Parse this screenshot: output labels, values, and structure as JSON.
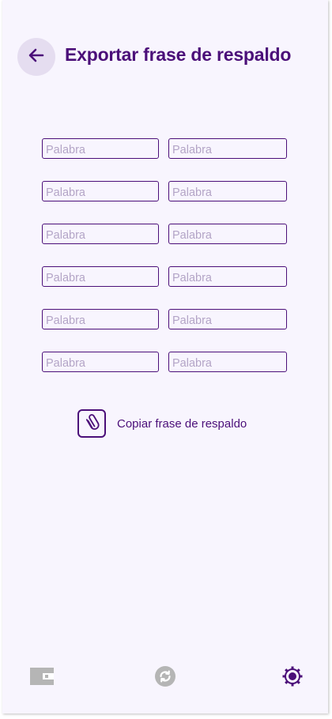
{
  "header": {
    "title": "Exportar frase de respaldo",
    "back_icon": "arrow-left-icon"
  },
  "words": [
    {
      "left": {
        "placeholder": "Palabra",
        "value": ""
      },
      "right": {
        "placeholder": "Palabra",
        "value": ""
      }
    },
    {
      "left": {
        "placeholder": "Palabra",
        "value": ""
      },
      "right": {
        "placeholder": "Palabra",
        "value": ""
      }
    },
    {
      "left": {
        "placeholder": "Palabra",
        "value": ""
      },
      "right": {
        "placeholder": "Palabra",
        "value": ""
      }
    },
    {
      "left": {
        "placeholder": "Palabra",
        "value": ""
      },
      "right": {
        "placeholder": "Palabra",
        "value": ""
      }
    },
    {
      "left": {
        "placeholder": "Palabra",
        "value": ""
      },
      "right": {
        "placeholder": "Palabra",
        "value": ""
      }
    },
    {
      "left": {
        "placeholder": "Palabra",
        "value": ""
      },
      "right": {
        "placeholder": "Palabra",
        "value": ""
      }
    }
  ],
  "copy": {
    "label": "Copiar frase de respaldo",
    "icon": "paperclip-icon"
  },
  "nav": {
    "items": [
      {
        "name": "wallet",
        "icon": "wallet-icon",
        "active": false
      },
      {
        "name": "exchange",
        "icon": "refresh-icon",
        "active": false
      },
      {
        "name": "settings",
        "icon": "gear-icon",
        "active": true
      }
    ]
  },
  "colors": {
    "primary": "#4b0f79",
    "background": "#f8f5fe",
    "back_button_bg": "#e5ddf0",
    "placeholder": "#b3a4c6",
    "inactive_icon": "#b5b5b5"
  }
}
